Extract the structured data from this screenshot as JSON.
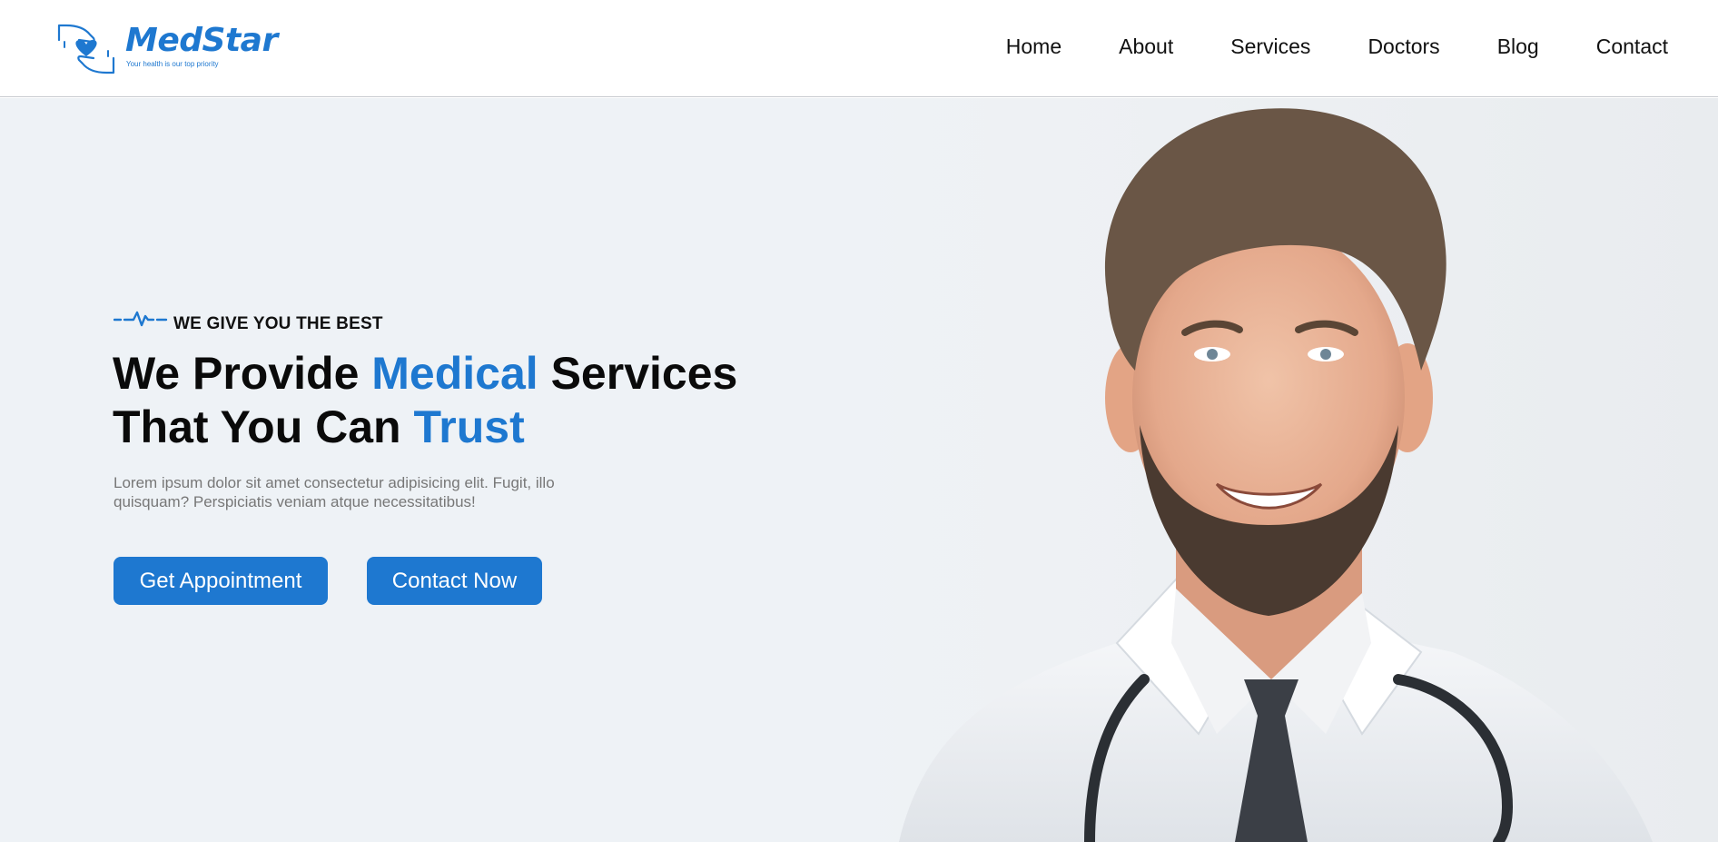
{
  "brand": {
    "name": "MedStar",
    "tagline": "Your health is our top priority",
    "color": "#1e78d0"
  },
  "nav": {
    "items": [
      {
        "label": "Home"
      },
      {
        "label": "About"
      },
      {
        "label": "Services"
      },
      {
        "label": "Doctors"
      },
      {
        "label": "Blog"
      },
      {
        "label": "Contact"
      }
    ]
  },
  "hero": {
    "eyebrow": "WE GIVE YOU THE BEST",
    "eyebrow_icon": "heartbeat-pulse-icon",
    "title": {
      "part1": "We Provide ",
      "accent1": "Medical",
      "part2": " Services",
      "part3": "That You Can ",
      "accent2": "Trust"
    },
    "description": "Lorem ipsum dolor sit amet consectetur adipisicing elit. Fugit, illo quisquam? Perspiciatis veniam atque necessitatibus!",
    "buttons": {
      "appointment": "Get Appointment",
      "contact": "Contact Now"
    },
    "image": "smiling-doctor-with-stethoscope"
  },
  "colors": {
    "accent": "#1e78d0",
    "hero_background": "#eef2f6",
    "text": "#0a0a0a"
  }
}
